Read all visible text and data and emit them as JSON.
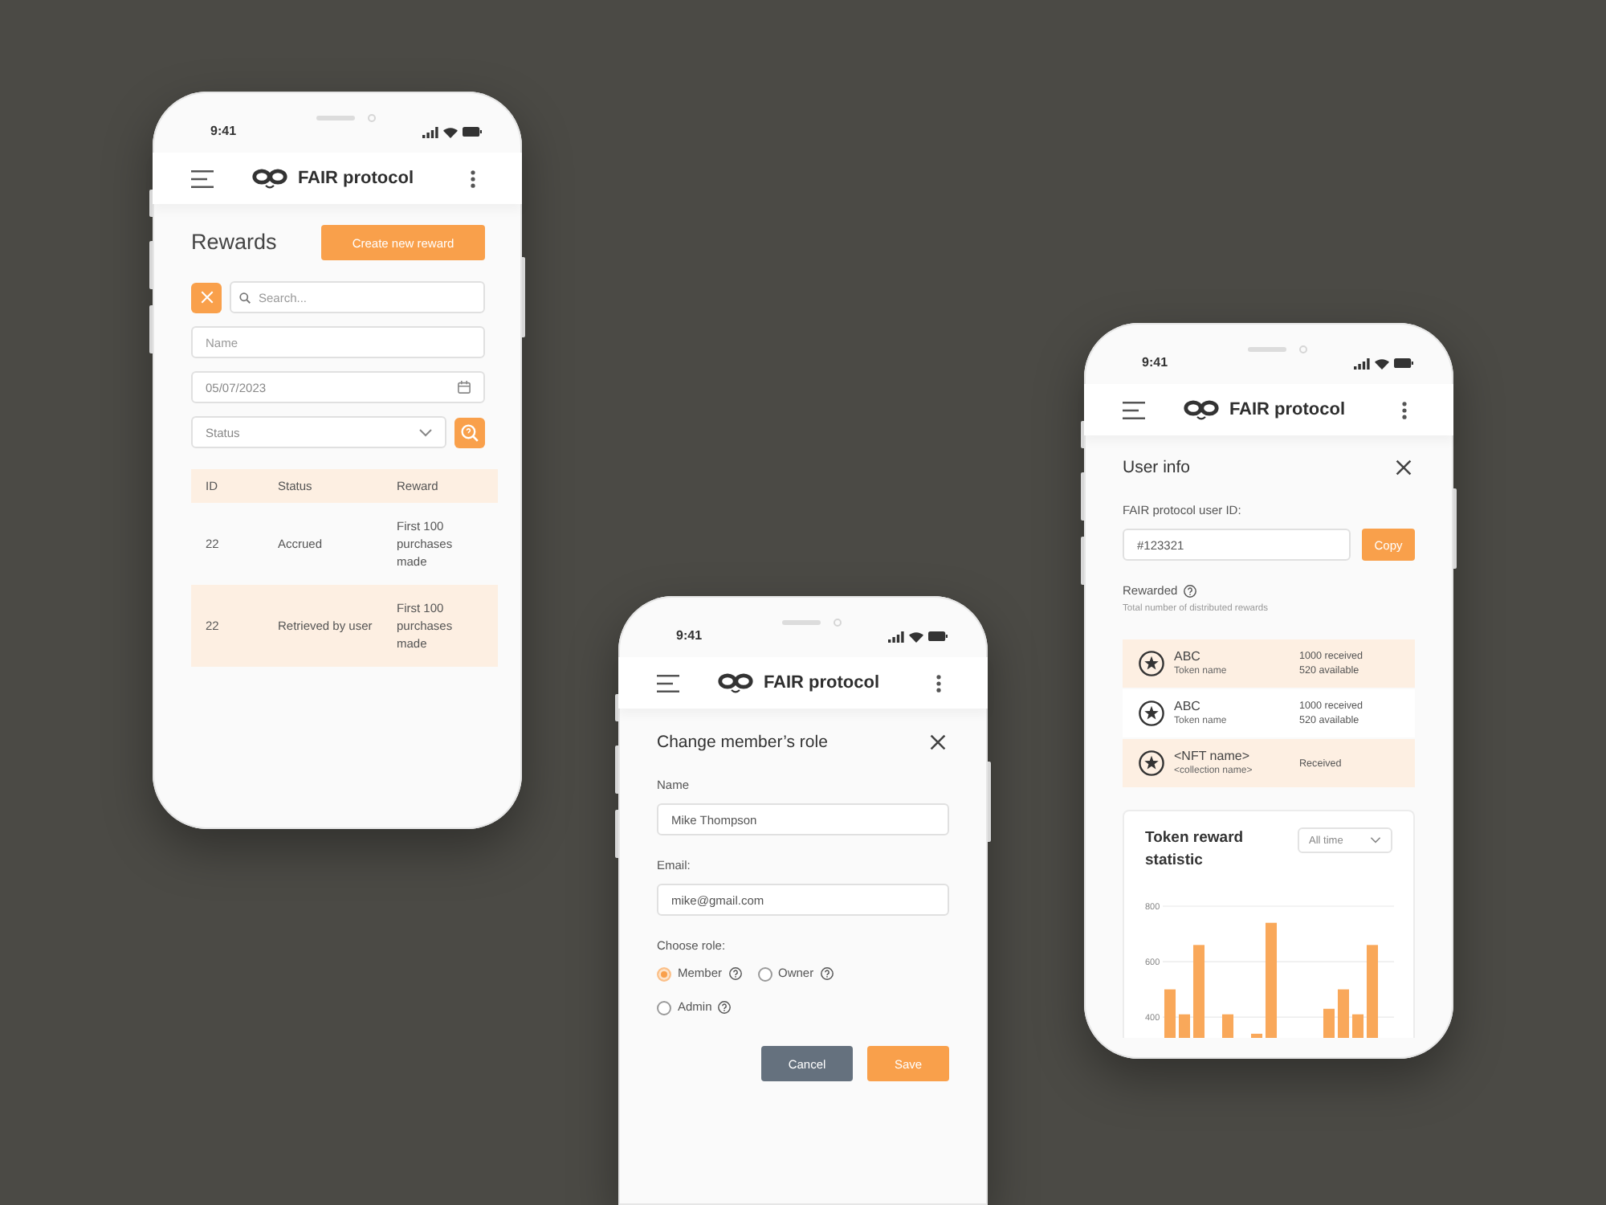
{
  "phones": [
    {
      "kind": "rewards",
      "time": "9:41",
      "app_title": "FAIR protocol",
      "title": "Rewards",
      "create_button": "Create new reward",
      "search": {
        "placeholder": "Search..."
      },
      "name_field": {
        "placeholder": "Name"
      },
      "date_field": {
        "value": "05/07/2023"
      },
      "status_select": {
        "placeholder": "Status"
      },
      "table": {
        "columns": [
          "ID",
          "Status",
          "Reward"
        ],
        "rows": [
          [
            "22",
            "Accrued",
            "First 100 purchases made"
          ],
          [
            "22",
            "Retrieved by user",
            "First 100 purchases made"
          ]
        ]
      }
    },
    {
      "kind": "change_role",
      "time": "9:41",
      "app_title": "FAIR protocol",
      "title": "Change member’s role",
      "fields": [
        {
          "label": "Name",
          "value": "Mike Thompson"
        },
        {
          "label": "Email:",
          "value": "mike@gmail.com"
        }
      ],
      "role_label": "Choose role:",
      "roles": [
        {
          "label": "Member",
          "selected": true
        },
        {
          "label": "Owner",
          "selected": false
        },
        {
          "label": "Admin",
          "selected": false
        }
      ],
      "buttons": [
        {
          "label": "Cancel",
          "kind": "secondary"
        },
        {
          "label": "Save",
          "kind": "primary"
        }
      ]
    },
    {
      "kind": "user_info",
      "time": "9:41",
      "app_title": "FAIR protocol",
      "title": "User info",
      "id_label": "FAIR protocol user ID:",
      "id_field": {
        "value": "#123321"
      },
      "copy_button": "Copy",
      "rewarded": {
        "label": "Rewarded",
        "hint": "Total number of distributed rewards"
      },
      "rewards": [
        {
          "name": "ABC",
          "subtitle": "Token name",
          "received": "1000 received",
          "available": "520 available"
        },
        {
          "name": "ABC",
          "subtitle": "Token name",
          "received": "1000 received",
          "available": "520 available"
        },
        {
          "name": "<NFT name>",
          "subtitle": "<collection name>",
          "received": "Received"
        }
      ],
      "statistic": {
        "title": "Token reward statistic",
        "period": "All time",
        "chart_data": {
          "type": "bar",
          "values": [
            500,
            410,
            660,
            null,
            410,
            null,
            340,
            740,
            null,
            null,
            null,
            430,
            500,
            410,
            660,
            null
          ],
          "yticks": [
            400,
            600,
            800
          ],
          "ylim": [
            325,
            800
          ],
          "grid": true
        }
      }
    }
  ]
}
